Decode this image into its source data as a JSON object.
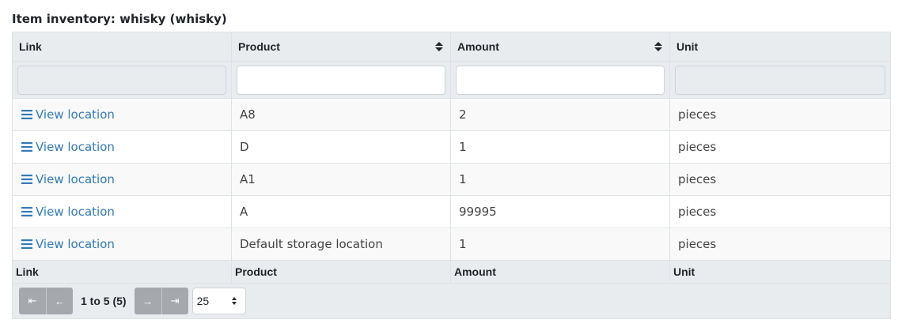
{
  "page_title": "Item inventory: whisky (whisky)",
  "table": {
    "headers": [
      "Link",
      "Product",
      "Amount",
      "Unit"
    ],
    "rows": [
      {
        "link": "View location",
        "product": "A8",
        "amount": "2",
        "unit": "pieces"
      },
      {
        "link": "View location",
        "product": "D",
        "amount": "1",
        "unit": "pieces"
      },
      {
        "link": "View location",
        "product": "A1",
        "amount": "1",
        "unit": "pieces"
      },
      {
        "link": "View location",
        "product": "A",
        "amount": "99995",
        "unit": "pieces"
      },
      {
        "link": "View location",
        "product": "Default storage location",
        "amount": "1",
        "unit": "pieces"
      }
    ],
    "footer": [
      "Link",
      "Product",
      "Amount",
      "Unit"
    ]
  },
  "pager": {
    "first": "⇤",
    "prev": "←",
    "next": "→",
    "last": "⇥",
    "info": "1 to 5 (5)",
    "page_size": "25"
  },
  "colors": {
    "link": "#337ab7",
    "header_bg": "#e9ecef",
    "pager_button": "#a5a9ad"
  }
}
